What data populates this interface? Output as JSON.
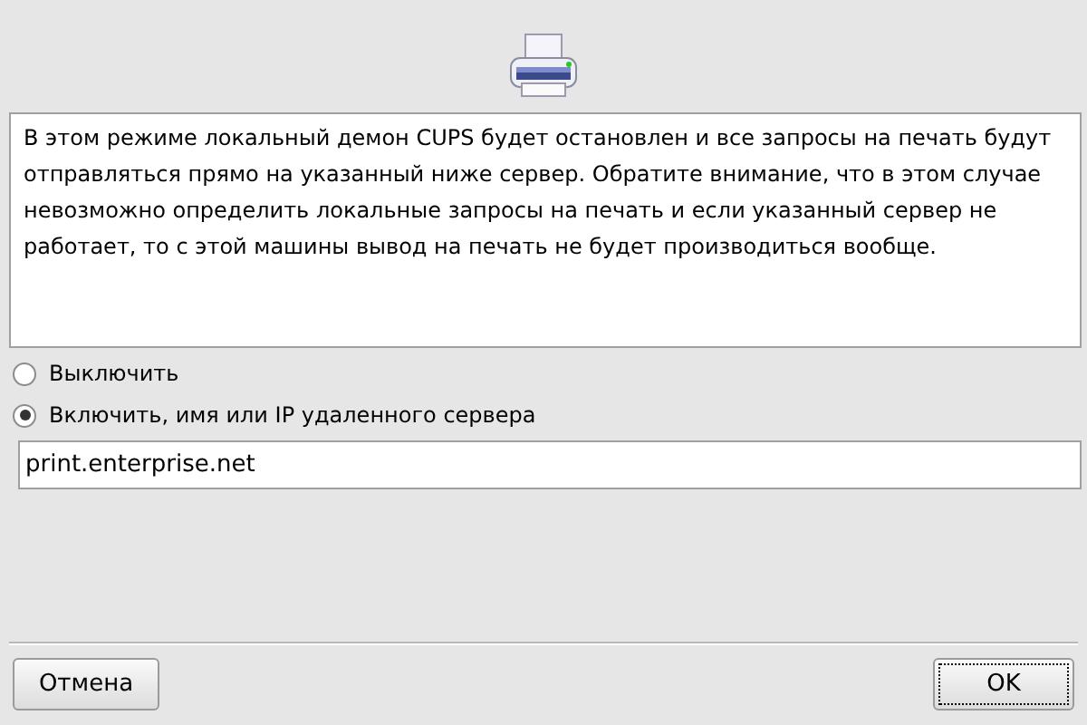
{
  "description": "В этом режиме локальный демон CUPS будет остановлен и все запросы на печать будут отправляться прямо на указанный ниже сервер. Обратите внимание, что в этом случае невозможно определить локальные запросы на печать и если указанный сервер не работает, то с этой машины вывод на печать не будет производиться вообще.",
  "options": [
    {
      "label": "Выключить",
      "selected": false
    },
    {
      "label": "Включить, имя или IP удаленного сервера",
      "selected": true
    }
  ],
  "server": {
    "value": "print.enterprise.net"
  },
  "buttons": [
    {
      "label": "Отмена",
      "focused": false
    },
    {
      "label": "OK",
      "focused": true
    }
  ]
}
